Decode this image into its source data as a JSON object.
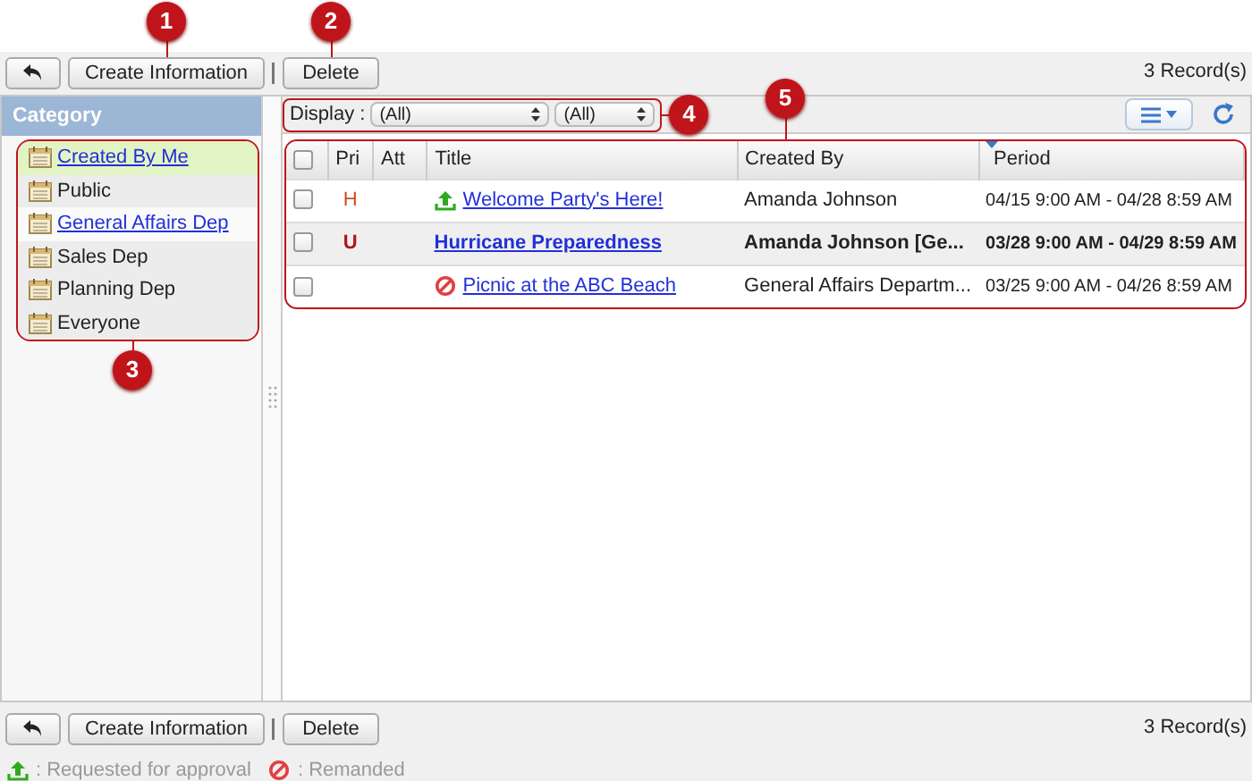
{
  "callouts": [
    {
      "number": "1"
    },
    {
      "number": "2"
    },
    {
      "number": "3"
    },
    {
      "number": "4"
    },
    {
      "number": "5"
    }
  ],
  "toolbar_top": {
    "buttons": [
      "Create Information",
      "Delete"
    ],
    "record_count": "3 Record(s)"
  },
  "sidebar": {
    "title": "Category",
    "items": [
      {
        "label": "Created By Me",
        "kind": "link",
        "selected": true
      },
      {
        "label": "Public",
        "kind": "plain",
        "selected": false
      },
      {
        "label": "General Affairs Dep",
        "kind": "link",
        "selected": false
      },
      {
        "label": "Sales Dep",
        "kind": "plain",
        "selected": false
      },
      {
        "label": "Planning Dep",
        "kind": "plain",
        "selected": false
      },
      {
        "label": "Everyone",
        "kind": "plain",
        "selected": false
      }
    ]
  },
  "filter": {
    "label": "Display :",
    "selects": [
      "(All)",
      "(All)"
    ]
  },
  "table": {
    "select_all_checked": false,
    "columns": [
      {
        "label": "Pri",
        "sorted": false
      },
      {
        "label": "Att",
        "sorted": false
      },
      {
        "label": "Title",
        "sorted": false
      },
      {
        "label": "Created By",
        "sorted": false
      },
      {
        "label": "Period",
        "sorted": true
      }
    ],
    "rows": [
      {
        "checked": false,
        "priority": "H",
        "kind": "approval",
        "title": "Welcome Party's Here!",
        "created_by": "Amanda Johnson",
        "period": "04/15 9:00 AM - 04/28 8:59 AM",
        "unread": false
      },
      {
        "checked": false,
        "priority": "U",
        "kind": "plain",
        "title": "Hurricane Preparedness",
        "created_by": "Amanda Johnson [Ge...",
        "period": "03/28 9:00 AM - 04/29 8:59 AM",
        "unread": true
      },
      {
        "checked": false,
        "priority": "",
        "kind": "remanded",
        "title": "Picnic at the ABC Beach",
        "created_by": "General Affairs Departm...",
        "period": "03/25 9:00 AM - 04/26 8:59 AM",
        "unread": false
      }
    ]
  },
  "toolbar_bottom": {
    "buttons": [
      "Create Information",
      "Delete"
    ],
    "record_count": "3 Record(s)"
  },
  "legend": [
    {
      "kind": "approval",
      "text": ": Requested for approval"
    },
    {
      "kind": "remanded",
      "text": ": Remanded"
    }
  ]
}
